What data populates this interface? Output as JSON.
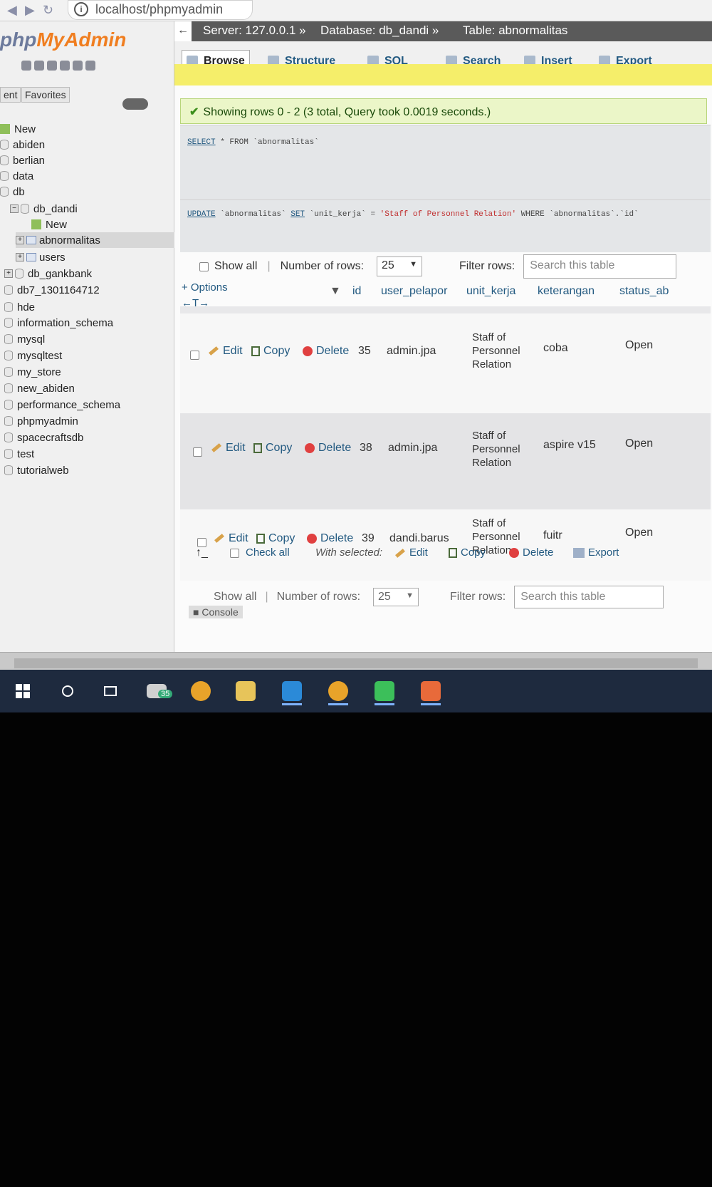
{
  "browser": {
    "url": "localhost/phpmyadmin"
  },
  "sidebar": {
    "logo_prefix": "php",
    "logo_brand": "MyAdmin",
    "tabs": [
      "ent",
      "Favorites"
    ],
    "tree": [
      {
        "label": "New"
      },
      {
        "label": "abiden"
      },
      {
        "label": "berlian"
      },
      {
        "label": "data"
      },
      {
        "label": "db"
      },
      {
        "label": "db_dandi"
      },
      {
        "label": "New"
      },
      {
        "label": "abnormalitas"
      },
      {
        "label": "users"
      },
      {
        "label": "db_gankbank"
      },
      {
        "label": "db7_1301164712"
      },
      {
        "label": "hde"
      },
      {
        "label": "information_schema"
      },
      {
        "label": "mysql"
      },
      {
        "label": "mysqltest"
      },
      {
        "label": "my_store"
      },
      {
        "label": "new_abiden"
      },
      {
        "label": "performance_schema"
      },
      {
        "label": "phpmyadmin"
      },
      {
        "label": "spacecraftsdb"
      },
      {
        "label": "test"
      },
      {
        "label": "tutorialweb"
      }
    ]
  },
  "breadcrumb": {
    "server": "Server: 127.0.0.1 »",
    "database": "Database: db_dandi »",
    "table": "Table: abnormalitas"
  },
  "tabs": [
    "Browse",
    "Structure",
    "SQL",
    "Search",
    "Insert",
    "Export"
  ],
  "message": {
    "success": "Showing rows 0 - 2 (3 total, Query took 0.0019 seconds.)"
  },
  "sql": {
    "select_kw": "SELECT",
    "select_rest": " * FROM `abnormalitas`",
    "update_kw": "UPDATE",
    "update_mid": " `abnormalitas` ",
    "set_kw": "SET",
    "update_col": " `unit_kerja` = ",
    "update_str": "'Staff of Personnel Relation'",
    "where_kw": " WHERE ",
    "update_end": "`abnormalitas`.`id`"
  },
  "controls": {
    "show_all": "Show all",
    "number_of_rows": "Number of rows:",
    "rows_value": "25",
    "filter_rows": "Filter rows:",
    "search_placeholder": "Search this table",
    "options": "+ Options",
    "arrows": "←T→"
  },
  "table": {
    "columns": [
      "id",
      "user_pelapor",
      "unit_kerja",
      "keterangan",
      "status_ab"
    ],
    "rows": [
      {
        "id": "35",
        "user_pelapor": "admin.jpa",
        "unit_kerja_1": "Staff of",
        "unit_kerja_2": "Personnel",
        "unit_kerja_3": "Relation",
        "keterangan": "coba",
        "status": "Open"
      },
      {
        "id": "38",
        "user_pelapor": "admin.jpa",
        "unit_kerja_1": "Staff of",
        "unit_kerja_2": "Personnel",
        "unit_kerja_3": "Relation",
        "keterangan": "aspire v15",
        "status": "Open"
      },
      {
        "id": "39",
        "user_pelapor": "dandi.barus",
        "unit_kerja_1": "Staff of",
        "unit_kerja_2": "Personnel",
        "unit_kerja_3": "Relation",
        "keterangan": "fuitr",
        "status": "Open"
      }
    ],
    "actions": {
      "edit": "Edit",
      "copy": "Copy",
      "delete": "Delete"
    }
  },
  "bulk": {
    "check_all": "Check all",
    "with_selected": "With selected:",
    "edit": "Edit",
    "copy": "Copy",
    "delete": "Delete",
    "export": "Export"
  },
  "console": "Console",
  "taskbar": {
    "mail_badge": "35"
  },
  "colors": {
    "accent": "#235a81",
    "brand": "#f07e20",
    "success_bg": "#ebf6c8"
  }
}
